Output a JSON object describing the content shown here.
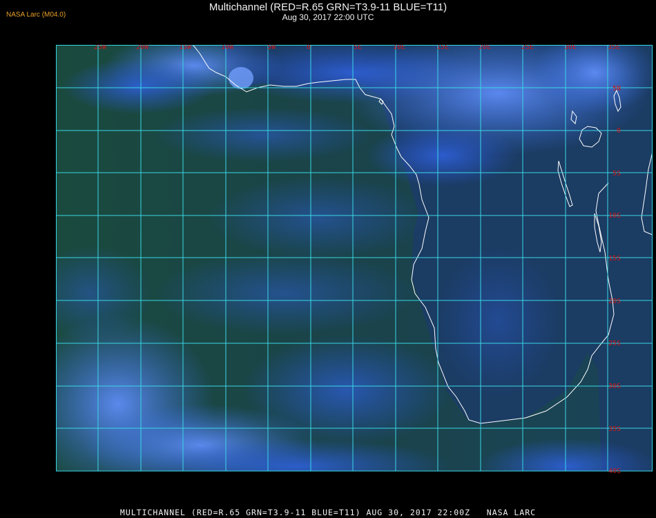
{
  "header": {
    "title": "Multichannel (RED=R.65 GRN=T3.9-11 BLUE=T11)",
    "subtitle": "Aug 30, 2017 22:00 UTC",
    "credit": "NASA Larc (M04.0)"
  },
  "footer": {
    "caption": "MULTICHANNEL (RED=R.65 GRN=T3.9-11 BLUE=T11) AUG 30, 2017 22:00Z   NASA LARC"
  },
  "map": {
    "longitude_labels": [
      "25W",
      "20W",
      "15W",
      "10W",
      "5W",
      "0",
      "5E",
      "10E",
      "15E",
      "20E",
      "25E",
      "30E",
      "35E"
    ],
    "latitude_labels": [
      "5N",
      "0",
      "5S",
      "10S",
      "15S",
      "20S",
      "25S",
      "30S",
      "35S",
      "40S"
    ],
    "colors": {
      "ocean": "#163f44",
      "land": "#19395a",
      "cloud": "#2f6ae8",
      "grid": "#38d8e6",
      "coast": "#ffffff",
      "label": "#d01818"
    }
  }
}
